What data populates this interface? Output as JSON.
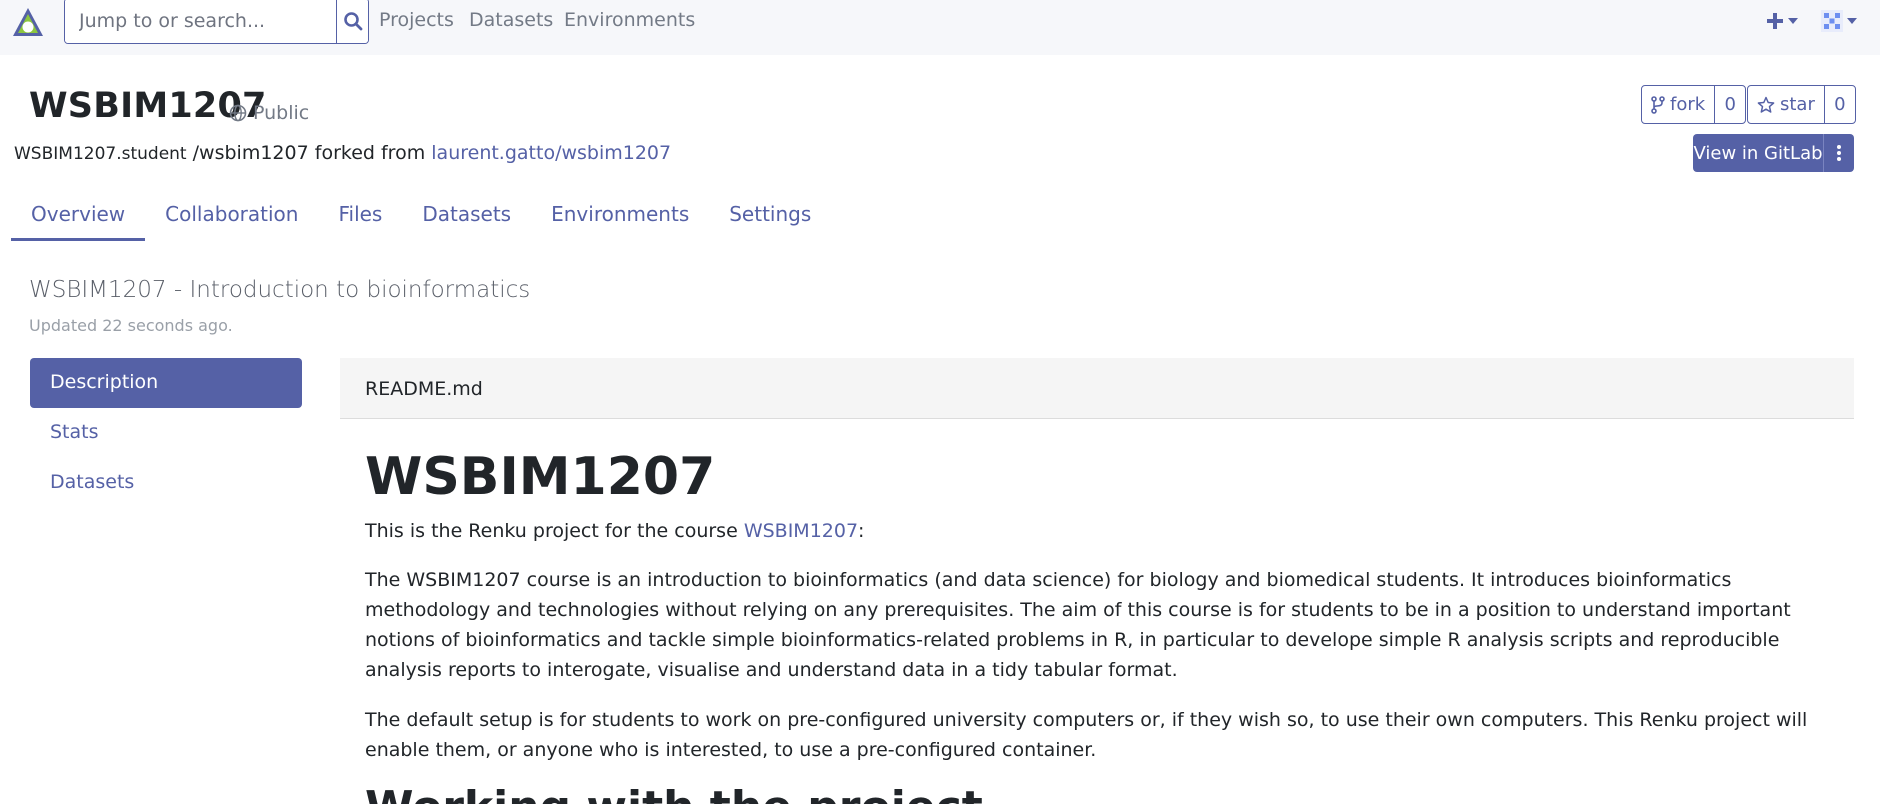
{
  "nav": {
    "search_placeholder": "Jump to or search...",
    "links": [
      "Projects",
      "Datasets",
      "Environments"
    ]
  },
  "header": {
    "title": "WSBIM1207",
    "visibility": "Public",
    "namespace": "WSBIM1207.student",
    "path": "/wsbim1207",
    "forked_from_label": "forked from",
    "forked_from": "laurent.gatto/wsbim1207",
    "fork_label": "fork",
    "fork_count": "0",
    "star_label": "star",
    "star_count": "0",
    "gitlab_label": "View in GitLab"
  },
  "tabs": [
    "Overview",
    "Collaboration",
    "Files",
    "Datasets",
    "Environments",
    "Settings"
  ],
  "overview": {
    "title": "WSBIM1207 - Introduction to bioinformatics",
    "updated": "Updated 22 seconds ago."
  },
  "side_nav": [
    "Description",
    "Stats",
    "Datasets"
  ],
  "readme": {
    "filename": "README.md",
    "h1": "WSBIM1207",
    "intro_prefix": "This is the Renku project for the course ",
    "intro_link": "WSBIM1207",
    "intro_suffix": ":",
    "p1": "The WSBIM1207 course is an introduction to bioinformatics (and data science) for biology and biomedical students. It introduces bioinformatics methodology and technologies without relying on any prerequisites. The aim of this course is for students to be in a position to understand important notions of bioinformatics and tackle simple bioinformatics-related problems in R, in particular to develope simple R analysis scripts and reproducible analysis reports to interogate, visualise and understand data in a tidy tabular format.",
    "p2": "The default setup is for students to work on pre-configured university computers or, if they wish so, to use their own computers. This Renku project will enable them, or anyone who is interested, to use a pre-configured container.",
    "h2": "Working with the project"
  },
  "colors": {
    "accent": "#5561a6",
    "navbar_bg": "#f6f7fa",
    "muted_text": "#737a86"
  }
}
